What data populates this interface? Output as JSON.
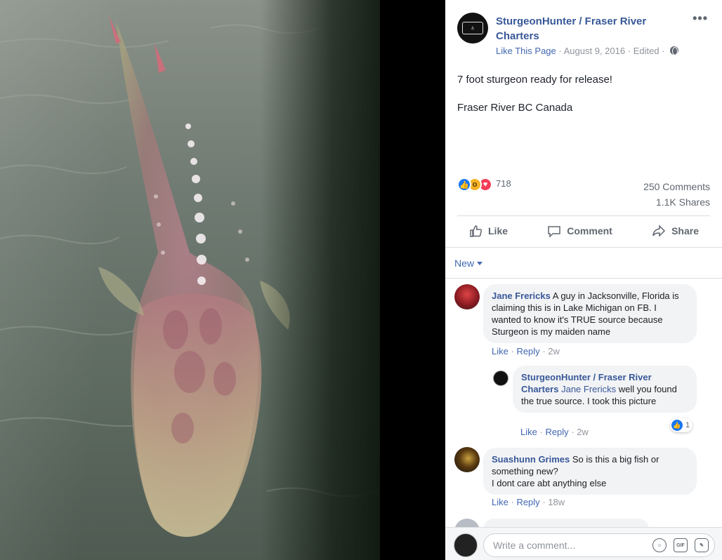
{
  "post": {
    "page_name": "SturgeonHunter / Fraser River Charters",
    "like_page": "Like This Page",
    "date": "August 9, 2016",
    "edited": "Edited",
    "separator": "·",
    "caption_line1": "7 foot sturgeon ready for release!",
    "caption_line2": "Fraser River BC Canada",
    "more_label": "•••"
  },
  "stats": {
    "reaction_count": "718",
    "reactions": [
      "like",
      "wow",
      "love"
    ],
    "comments": "250 Comments",
    "shares": "1.1K Shares"
  },
  "actions": {
    "like": "Like",
    "comment": "Comment",
    "share": "Share"
  },
  "sort": {
    "label": "New"
  },
  "comments": [
    {
      "author": "Jane Frericks",
      "text": "A guy in Jacksonville, Florida is claiming this is in Lake Michigan on FB. I wanted to know it's TRUE source because Sturgeon is my maiden name",
      "like": "Like",
      "reply": "Reply",
      "time": "2w"
    },
    {
      "author": "SturgeonHunter / Fraser River Charters",
      "tag": "Jane Frericks",
      "text": "well you found the true source. I took this picture",
      "like": "Like",
      "reply": "Reply",
      "time": "2w",
      "like_count": "1"
    },
    {
      "author": "Suashunn Grimes",
      "text_line1": "So is this a big fish or something new?",
      "text_line2": "I dont care abt anything else",
      "like": "Like",
      "reply": "Reply",
      "time": "18w"
    }
  ],
  "composer": {
    "placeholder": "Write a comment..."
  },
  "colors": {
    "link_blue": "#385898",
    "action_blue": "#4267b2",
    "like_blue": "#1877f2",
    "wow_yellow": "#f7b125",
    "love_red": "#f33e58"
  }
}
